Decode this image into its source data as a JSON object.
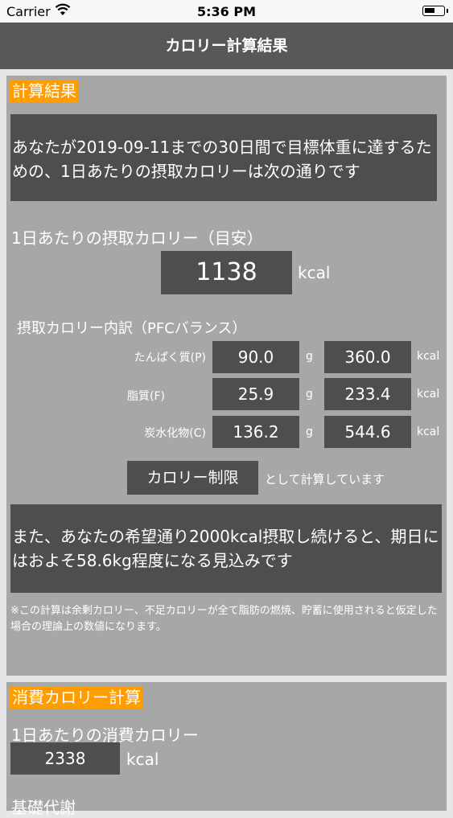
{
  "status_bar": {
    "carrier": "Carrier",
    "time": "5:36 PM"
  },
  "nav": {
    "title": "カロリー計算結果"
  },
  "result": {
    "section_title": "計算結果",
    "intro": "あなたが2019-09-11までの30日間で目標体重に達するための、1日あたりの摂取カロリーは次の通りです",
    "daily_label": "1日あたりの摂取カロリー（目安）",
    "daily_value": "1138",
    "daily_unit": "kcal",
    "pfc_title": "摂取カロリー内訳（PFCバランス）",
    "pfc_rows": [
      {
        "label": "たんぱく質(P)",
        "grams": "90.0",
        "g_unit": "g",
        "kcal": "360.0",
        "kcal_unit": "kcal"
      },
      {
        "label": "脂質(F)",
        "grams": "25.9",
        "g_unit": "g",
        "kcal": "233.4",
        "kcal_unit": "kcal"
      },
      {
        "label": "炭水化物(C)",
        "grams": "136.2",
        "g_unit": "g",
        "kcal": "544.6",
        "kcal_unit": "kcal"
      }
    ],
    "mode_button": "カロリー制限",
    "mode_suffix": "として計算しています",
    "forecast": "また、あなたの希望通り2000kcal摂取し続けると、期日にはおよそ58.6kg程度になる見込みです",
    "note": "※この計算は余剰カロリー、不足カロリーが全て脂肪の燃焼、貯蓄に使用されると仮定した場合の理論上の数値になります。"
  },
  "consumption": {
    "section_title": "消費カロリー計算",
    "daily_label": "1日あたりの消費カロリー",
    "daily_value": "2338",
    "daily_unit": "kcal",
    "next_label": "基礎代謝"
  }
}
